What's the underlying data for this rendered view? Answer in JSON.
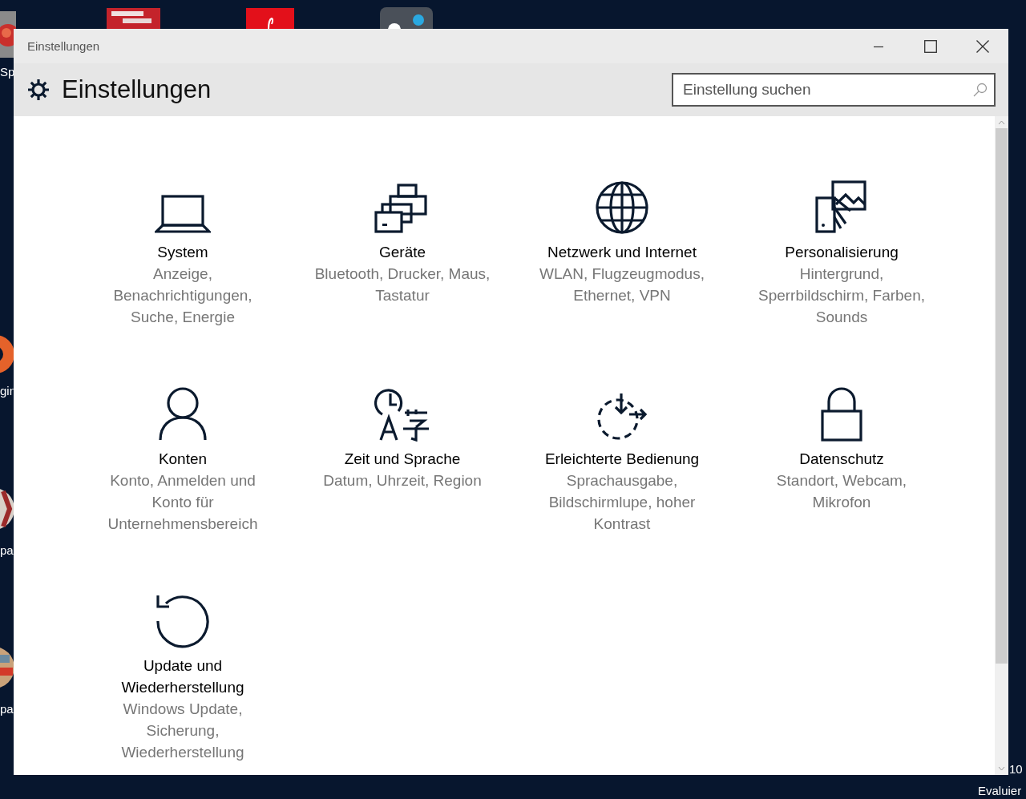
{
  "desktop": {
    "icon_labels": [
      {
        "text": "Sp"
      },
      {
        "text": "gin"
      },
      {
        "text": "pa"
      },
      {
        "text": "pa"
      }
    ],
    "corner_text": [
      "10",
      "Evaluier"
    ]
  },
  "window": {
    "title": "Einstellungen",
    "header": {
      "title": "Einstellungen",
      "search": {
        "placeholder": "Einstellung suchen"
      }
    },
    "categories": [
      {
        "kind": "laptop",
        "title": "System",
        "subtitle": "Anzeige, Benachrichtigungen, Suche, Energie"
      },
      {
        "kind": "devices",
        "title": "Geräte",
        "subtitle": "Bluetooth, Drucker, Maus, Tastatur"
      },
      {
        "kind": "globe",
        "title": "Netzwerk und Internet",
        "subtitle": "WLAN, Flugzeugmodus, Ethernet, VPN"
      },
      {
        "kind": "personalize",
        "title": "Personalisierung",
        "subtitle": "Hintergrund, Sperrbildschirm, Farben, Sounds"
      },
      {
        "kind": "person",
        "title": "Konten",
        "subtitle": "Konto, Anmelden und Konto für Unternehmensbereich"
      },
      {
        "kind": "time",
        "title": "Zeit und Sprache",
        "subtitle": "Datum, Uhrzeit, Region"
      },
      {
        "kind": "ease",
        "title": "Erleichterte Bedienung",
        "subtitle": "Sprachausgabe, Bildschirmlupe, hoher Kontrast"
      },
      {
        "kind": "lock",
        "title": "Datenschutz",
        "subtitle": "Standort, Webcam, Mikrofon"
      },
      {
        "kind": "update",
        "title": "Update und Wiederherstellung",
        "subtitle": "Windows Update, Sicherung, Wiederherstellung"
      }
    ]
  }
}
